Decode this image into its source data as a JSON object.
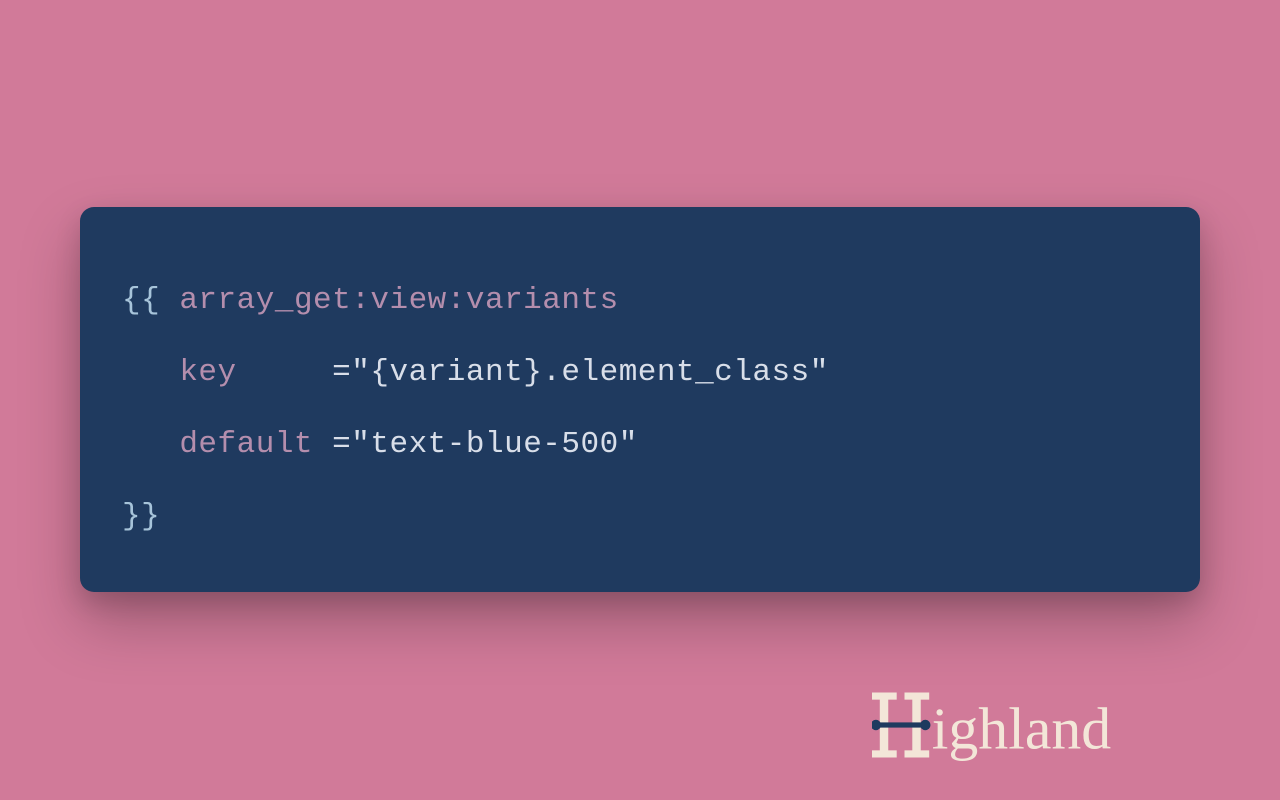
{
  "code": {
    "open": "{{",
    "close": "}}",
    "tag": "array_get:view:variants",
    "attrs": [
      {
        "name": "key",
        "pad": "    ",
        "value": "\"{variant}.element_class\""
      },
      {
        "name": "default",
        "pad": "",
        "value": "\"text-blue-500\""
      }
    ]
  },
  "brand": {
    "name": "Highland"
  }
}
